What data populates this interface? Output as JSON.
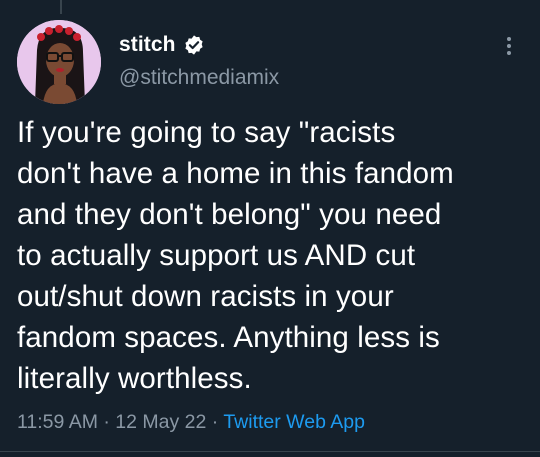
{
  "author": {
    "display_name": "stitch",
    "handle": "@stitchmediamix",
    "verified": true,
    "avatar_icon": "profile-avatar"
  },
  "tweet": {
    "text": "If you're going to say \"racists\ndon't have a home in this fandom\nand they don't belong\" you need\nto actually support us AND cut\nout/shut down racists in your\nfandom spaces. Anything less is\nliterally worthless."
  },
  "meta": {
    "time": "11:59 AM",
    "separator": " · ",
    "date": "12 May 22",
    "source": "Twitter Web App"
  },
  "icons": {
    "verified": "verified-badge-icon",
    "more": "more-options-icon"
  },
  "colors": {
    "background": "#15202b",
    "text": "#ffffff",
    "secondary_text": "#8b98a5",
    "link": "#1d9bf0"
  }
}
